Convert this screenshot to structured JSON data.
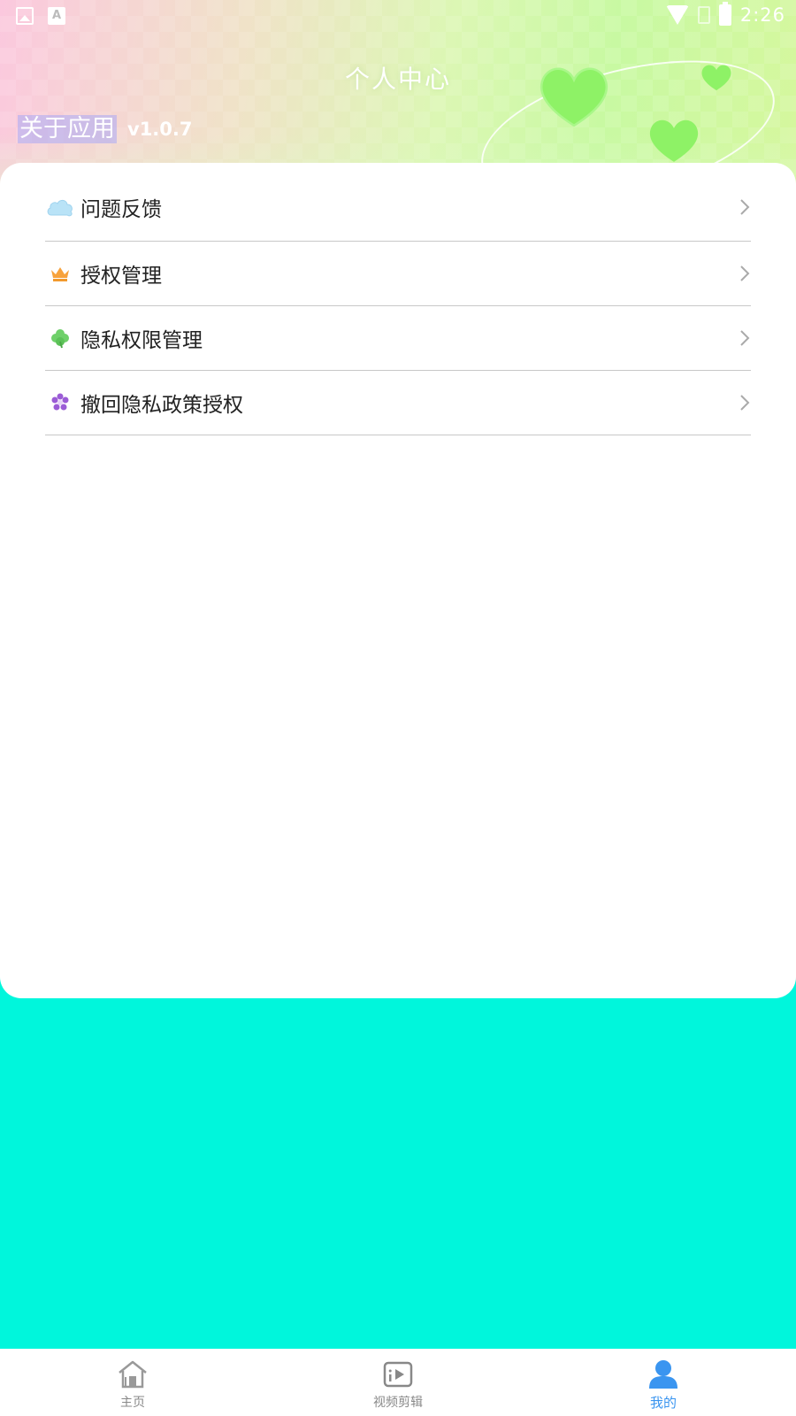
{
  "status_bar": {
    "time": "2:26",
    "icons": [
      "image-icon",
      "a-icon",
      "wifi-icon",
      "no-sim-icon",
      "battery-charging-icon"
    ]
  },
  "header": {
    "title": "个人中心",
    "about_label": "关于应用",
    "version": "v1.0.7"
  },
  "menu": {
    "items": [
      {
        "label": "问题反馈",
        "icon": "cloud-icon"
      },
      {
        "label": "授权管理",
        "icon": "crown-icon"
      },
      {
        "label": "隐私权限管理",
        "icon": "clover-icon"
      },
      {
        "label": "撤回隐私政策授权",
        "icon": "flower-icon"
      }
    ]
  },
  "bottom_nav": {
    "items": [
      {
        "label": "主页",
        "icon": "home-icon",
        "active": false
      },
      {
        "label": "视频剪辑",
        "icon": "video-edit-icon",
        "active": false
      },
      {
        "label": "我的",
        "icon": "profile-icon",
        "active": true
      }
    ]
  },
  "colors": {
    "background": "#00f6dc",
    "accent": "#3a95f0",
    "card": "#ffffff",
    "divider": "#c8c8c8"
  }
}
